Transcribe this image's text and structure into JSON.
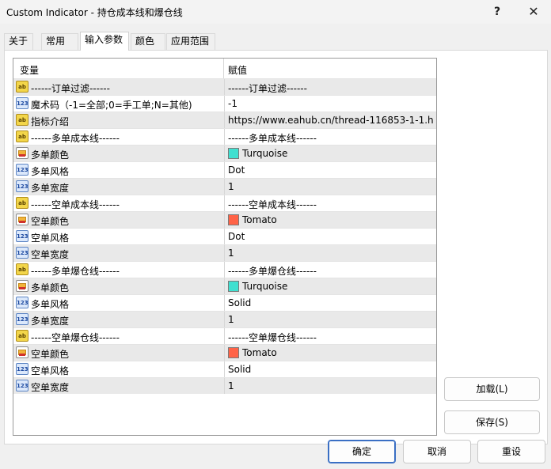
{
  "window": {
    "title": "Custom Indicator - 持仓成本线和爆仓线",
    "help_label": "?",
    "close_label": "✕"
  },
  "tabs": [
    {
      "label": "关于"
    },
    {
      "label": "常用"
    },
    {
      "label": "输入参数"
    },
    {
      "label": "颜色"
    },
    {
      "label": "应用范围"
    }
  ],
  "grid": {
    "col_variable": "变量",
    "col_value": "赋值",
    "rows": [
      {
        "icon": "ab",
        "name": "------订单过滤------",
        "value": "------订单过滤------"
      },
      {
        "icon": "num",
        "name": "魔术码（-1=全部;0=手工单;N=其他)",
        "value": "-1"
      },
      {
        "icon": "ab",
        "name": "指标介绍",
        "value": "https://www.eahub.cn/thread-116853-1-1.h..."
      },
      {
        "icon": "ab",
        "name": "------多单成本线------",
        "value": "------多单成本线------"
      },
      {
        "icon": "color",
        "name": "多单颜色",
        "value": "Turquoise",
        "swatch": "#40e0d0"
      },
      {
        "icon": "num",
        "name": "多单风格",
        "value": "Dot"
      },
      {
        "icon": "num",
        "name": "多单宽度",
        "value": "1"
      },
      {
        "icon": "ab",
        "name": "------空单成本线------",
        "value": "------空单成本线------"
      },
      {
        "icon": "color",
        "name": "空单颜色",
        "value": "Tomato",
        "swatch": "#ff6347"
      },
      {
        "icon": "num",
        "name": "空单风格",
        "value": "Dot"
      },
      {
        "icon": "num",
        "name": "空单宽度",
        "value": "1"
      },
      {
        "icon": "ab",
        "name": "------多单爆仓线------",
        "value": "------多单爆仓线------"
      },
      {
        "icon": "color",
        "name": "多单颜色",
        "value": "Turquoise",
        "swatch": "#40e0d0"
      },
      {
        "icon": "num",
        "name": "多单风格",
        "value": "Solid"
      },
      {
        "icon": "num",
        "name": "多单宽度",
        "value": "1"
      },
      {
        "icon": "ab",
        "name": "------空单爆仓线------",
        "value": "------空单爆仓线------"
      },
      {
        "icon": "color",
        "name": "空单颜色",
        "value": "Tomato",
        "swatch": "#ff6347"
      },
      {
        "icon": "num",
        "name": "空单风格",
        "value": "Solid"
      },
      {
        "icon": "num",
        "name": "空单宽度",
        "value": "1"
      }
    ]
  },
  "icons": {
    "ab": "ab",
    "num": "123",
    "color": "color-icon"
  },
  "buttons": {
    "load": "加载(L)",
    "save": "保存(S)",
    "ok": "确定",
    "cancel": "取消",
    "reset": "重设"
  },
  "colors": {
    "accent": "#3a6fc4",
    "shade_row": "#e9e9e9"
  }
}
